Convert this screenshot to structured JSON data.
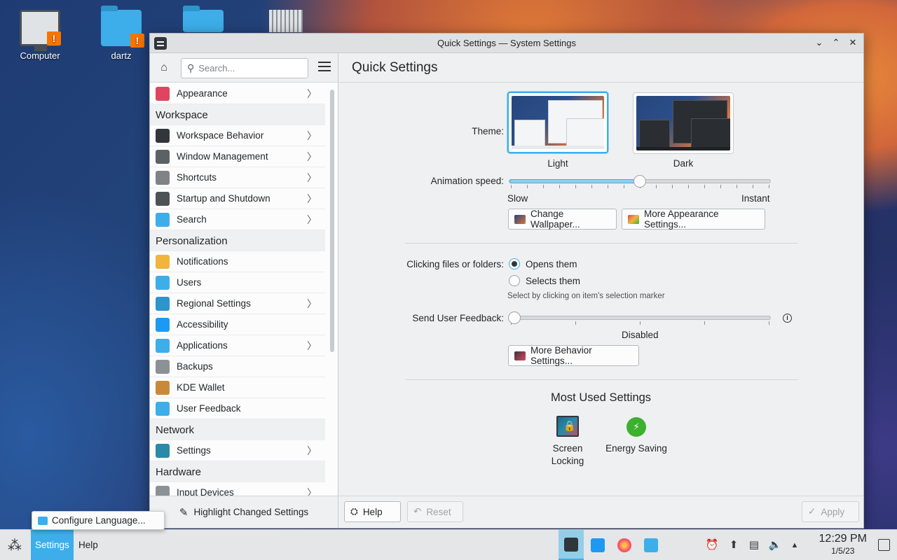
{
  "desktop": {
    "icons": [
      {
        "label": "Computer"
      },
      {
        "label": "dartz"
      },
      {
        "label": ""
      },
      {
        "label": ""
      }
    ]
  },
  "window": {
    "title": "Quick Settings — System Settings",
    "controls": {
      "minimize": "⌄",
      "maximize": "⌃",
      "close": "✕"
    }
  },
  "sidebar": {
    "search_placeholder": "Search...",
    "items": [
      {
        "type": "item",
        "label": "Appearance",
        "icon_color": "#e0445e",
        "chevron": true
      },
      {
        "type": "category",
        "label": "Workspace"
      },
      {
        "type": "item",
        "label": "Workspace Behavior",
        "icon_color": "#31363b",
        "chevron": true
      },
      {
        "type": "item",
        "label": "Window Management",
        "icon_color": "#5c6166",
        "chevron": true
      },
      {
        "type": "item",
        "label": "Shortcuts",
        "icon_color": "#7f8386",
        "chevron": true
      },
      {
        "type": "item",
        "label": "Startup and Shutdown",
        "icon_color": "#4d5257",
        "chevron": true
      },
      {
        "type": "item",
        "label": "Search",
        "icon_color": "#3daee9",
        "chevron": true
      },
      {
        "type": "category",
        "label": "Personalization"
      },
      {
        "type": "item",
        "label": "Notifications",
        "icon_color": "#f0b53a",
        "chevron": false
      },
      {
        "type": "item",
        "label": "Users",
        "icon_color": "#3daee9",
        "chevron": false
      },
      {
        "type": "item",
        "label": "Regional Settings",
        "icon_color": "#2c95cc",
        "chevron": true
      },
      {
        "type": "item",
        "label": "Accessibility",
        "icon_color": "#1d99f3",
        "chevron": false
      },
      {
        "type": "item",
        "label": "Applications",
        "icon_color": "#3daee9",
        "chevron": true
      },
      {
        "type": "item",
        "label": "Backups",
        "icon_color": "#8c9196",
        "chevron": false
      },
      {
        "type": "item",
        "label": "KDE Wallet",
        "icon_color": "#c88a3a",
        "chevron": false
      },
      {
        "type": "item",
        "label": "User Feedback",
        "icon_color": "#3daee9",
        "chevron": false
      },
      {
        "type": "category",
        "label": "Network"
      },
      {
        "type": "item",
        "label": "Settings",
        "icon_color": "#2a8aa8",
        "chevron": true
      },
      {
        "type": "category",
        "label": "Hardware"
      },
      {
        "type": "item",
        "label": "Input Devices",
        "icon_color": "#8c9196",
        "chevron": true
      }
    ],
    "footer_label": "Highlight Changed Settings"
  },
  "main": {
    "header": "Quick Settings",
    "theme_label": "Theme:",
    "themes": [
      {
        "name": "Light",
        "selected": true
      },
      {
        "name": "Dark",
        "selected": false
      }
    ],
    "animation_label": "Animation speed:",
    "animation_slow": "Slow",
    "animation_instant": "Instant",
    "animation_value_fraction": 0.5,
    "change_wallpaper": "Change Wallpaper...",
    "more_appearance": "More Appearance Settings...",
    "clicking_label": "Clicking files or folders:",
    "opens_them": "Opens them",
    "selects_them": "Selects them",
    "selects_hint": "Select by clicking on item's selection marker",
    "feedback_label": "Send User Feedback:",
    "feedback_value": "Disabled",
    "more_behavior": "More Behavior Settings...",
    "most_used_title": "Most Used Settings",
    "most_used": [
      {
        "label": "Screen\nLocking",
        "icon": "screen-locking-icon"
      },
      {
        "label": "Energy Saving",
        "icon": "energy-saving-icon"
      }
    ],
    "energy_glyph": "⚡"
  },
  "footer": {
    "help": "Help",
    "reset": "Reset",
    "apply": "Apply"
  },
  "tooltip": {
    "label": "Configure Language..."
  },
  "panel": {
    "menus": [
      {
        "label": "Settings",
        "active": true
      },
      {
        "label": "Help",
        "active": false
      }
    ],
    "time": "12:29 PM",
    "date": "1/5/23"
  }
}
